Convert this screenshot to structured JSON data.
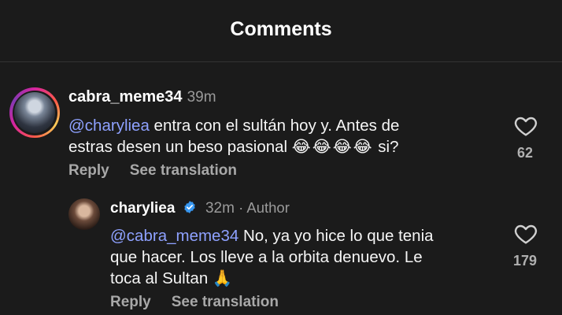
{
  "header": {
    "title": "Comments"
  },
  "comments": [
    {
      "username": "cabra_meme34",
      "time": "39m",
      "mention": "@charyliea",
      "text_line1": " entra con el sultán hoy y. Antes de",
      "text_line2": "estras desen un beso pasional ",
      "emojis": "😂😂😂😂",
      "text_end": " si?",
      "likes": "62",
      "reply_label": "Reply",
      "translate_label": "See translation"
    }
  ],
  "reply": {
    "username": "charyliea",
    "time": "32m",
    "author_tag": " · Author",
    "mention": "@cabra_meme34",
    "text_line1": " No, ya yo hice lo que tenia",
    "text_line2": "que hacer. Los lleve a la orbita denuevo. Le",
    "text_line3": "toca al Sultan ",
    "emoji": "🙏",
    "likes": "179",
    "reply_label": "Reply",
    "translate_label": "See translation"
  },
  "colors": {
    "mention": "#8ea1ff",
    "verified": "#3897f0",
    "background": "#1b1b1b"
  }
}
